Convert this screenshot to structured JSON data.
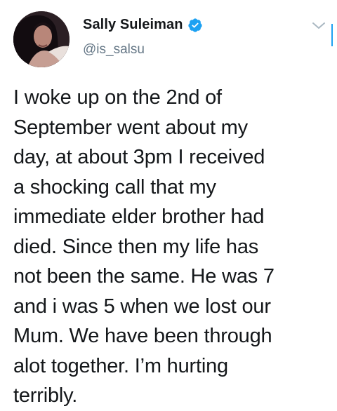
{
  "author": {
    "display_name": "Sally Suleiman",
    "handle": "@is_salsu",
    "verified": true,
    "avatar_icon": "profile-photo"
  },
  "tweet": {
    "text": "I woke up on the 2nd of\nSeptember went about my\nday, at about 3pm I received\na shocking call that my\nimmediate elder brother had\ndied. Since then my life has\nnot been the same. He was 7\nand i was 5 when we lost our\nMum. We have been through\nalot together. I’m hurting\nterribly."
  },
  "colors": {
    "verified_badge": "#1da1f2",
    "handle_text": "#657786",
    "body_text": "#14171a",
    "chevron": "#aab8c2"
  },
  "icons": {
    "verified": "verified-badge-icon",
    "menu": "chevron-down-icon"
  }
}
